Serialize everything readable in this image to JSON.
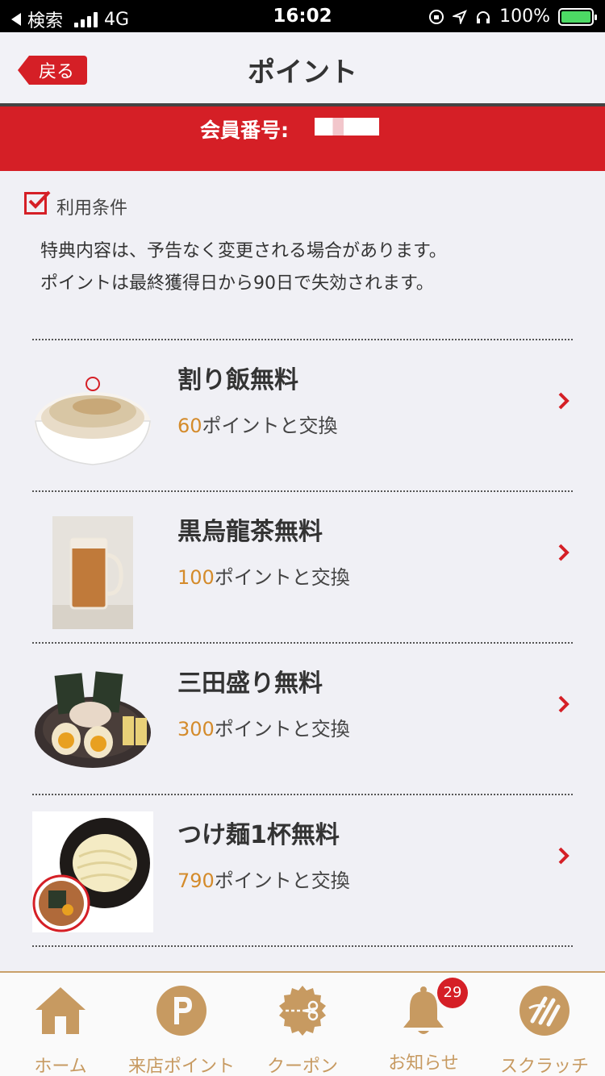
{
  "status_bar": {
    "back_app": "検索",
    "network": "4G",
    "time": "16:02",
    "battery": "100%"
  },
  "nav": {
    "back_label": "戻る",
    "title": "ポイント"
  },
  "member": {
    "label": "会員番号:"
  },
  "terms": {
    "heading": "利用条件",
    "line1": "特典内容は、予告なく変更される場合があります。",
    "line2": "ポイントは最終獲得日から90日で失効されます。"
  },
  "rewards": [
    {
      "name": "割り飯無料",
      "points": "60",
      "suffix": "ポイントと交換",
      "image": "rice-bowl"
    },
    {
      "name": "黒烏龍茶無料",
      "points": "100",
      "suffix": "ポイントと交換",
      "image": "oolong-tea-mug"
    },
    {
      "name": "三田盛り無料",
      "points": "300",
      "suffix": "ポイントと交換",
      "image": "topping-plate"
    },
    {
      "name": "つけ麺1杯無料",
      "points": "790",
      "suffix": "ポイントと交換",
      "image": "tsukemen"
    }
  ],
  "tabs": [
    {
      "label": "ホーム",
      "icon": "home-icon"
    },
    {
      "label": "来店ポイント",
      "icon": "points-icon"
    },
    {
      "label": "クーポン",
      "icon": "coupon-icon"
    },
    {
      "label": "お知らせ",
      "icon": "bell-icon",
      "badge": "29"
    },
    {
      "label": "スクラッチ",
      "icon": "scratch-icon"
    }
  ],
  "colors": {
    "brand_red": "#d51f26",
    "points_orange": "#d48b2b",
    "tab_gold": "#c79a61"
  }
}
